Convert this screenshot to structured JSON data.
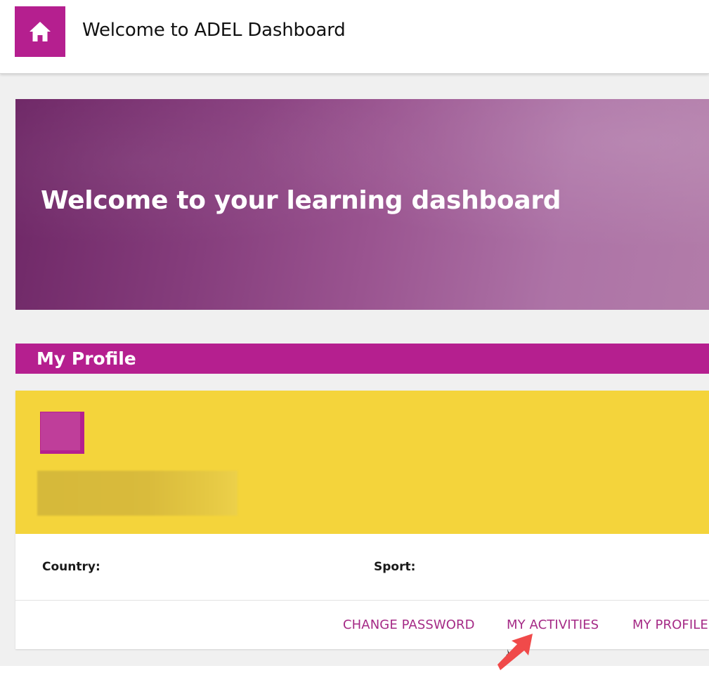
{
  "header": {
    "title": "Welcome to ADEL Dashboard",
    "home_icon": "home-icon"
  },
  "hero": {
    "title": "Welcome to your learning dashboard"
  },
  "profile_section": {
    "title": "My Profile",
    "fields": {
      "country_label": "Country:",
      "sport_label": "Sport:"
    },
    "actions": {
      "change_password": "CHANGE PASSWORD",
      "my_activities": "MY ACTIVITIES",
      "my_profile": "MY PROFILE"
    }
  },
  "colors": {
    "brand_magenta": "#b51f8f",
    "profile_yellow": "#f4d43b",
    "link_color": "#a52a86",
    "annotation_arrow": "#f04a4a"
  }
}
